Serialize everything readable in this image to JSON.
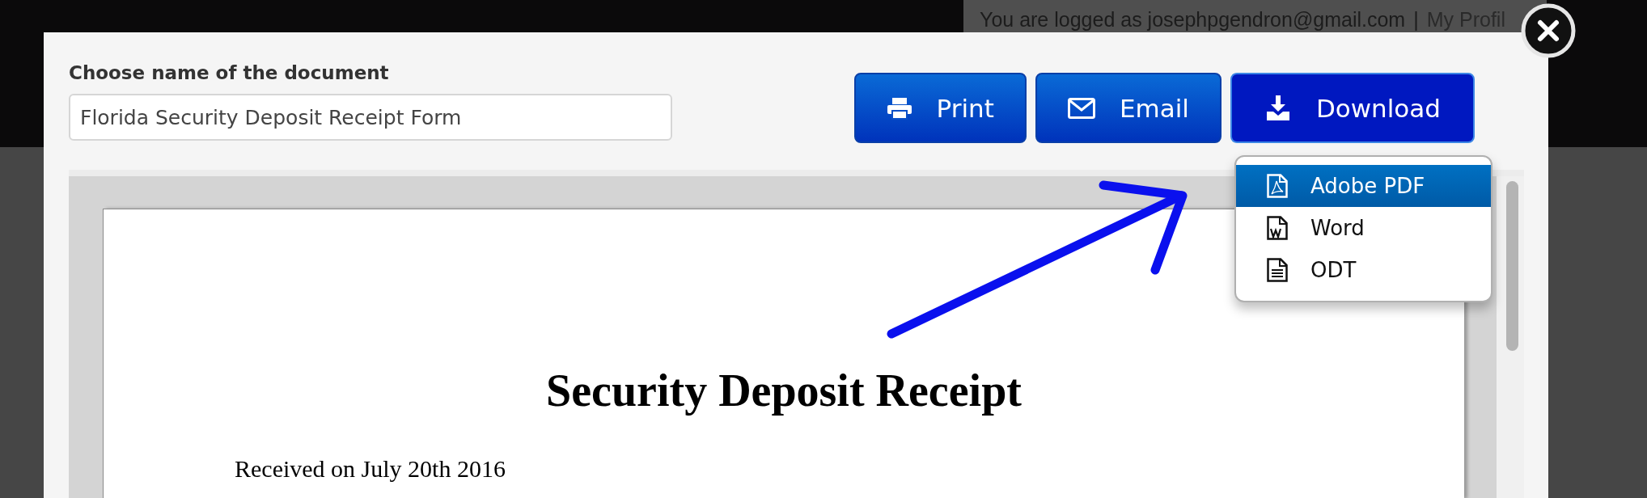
{
  "header": {
    "login_text": "You are logged as josephpgendron@gmail.com",
    "separator": "|",
    "profile_link": "My Profil"
  },
  "name_field": {
    "label": "Choose name of the document",
    "value": "Florida Security Deposit Receipt Form"
  },
  "buttons": [
    {
      "label": "Print",
      "kind": "print",
      "selected": false
    },
    {
      "label": "Email",
      "kind": "email",
      "selected": false
    },
    {
      "label": "Download",
      "kind": "download",
      "selected": true
    }
  ],
  "download_menu": {
    "items": [
      {
        "label": "Adobe PDF",
        "kind": "pdf",
        "selected": true
      },
      {
        "label": "Word",
        "kind": "word",
        "selected": false
      },
      {
        "label": "ODT",
        "kind": "odt",
        "selected": false
      }
    ]
  },
  "document": {
    "title": "Security Deposit Receipt",
    "lines": [
      "Received on July 20th 2016"
    ]
  }
}
